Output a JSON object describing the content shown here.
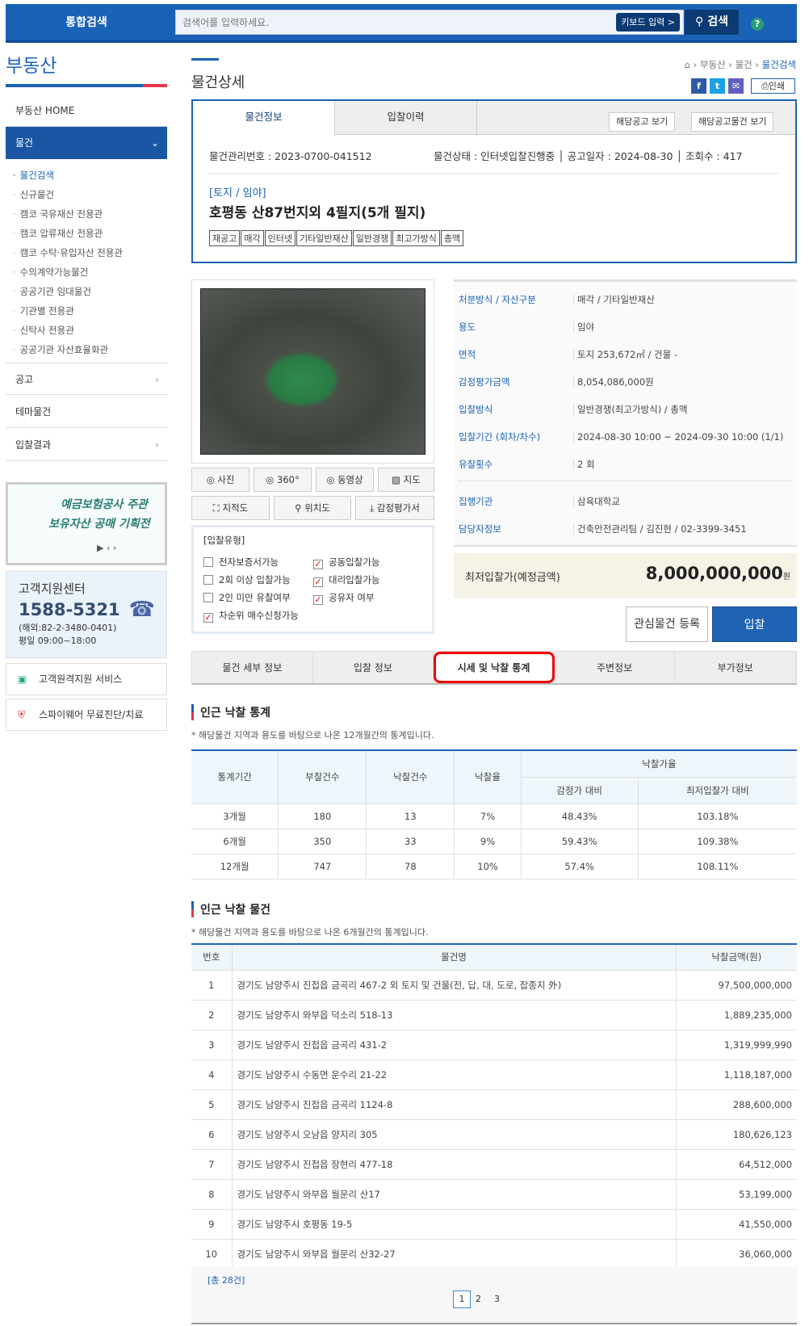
{
  "topbar": {
    "label": "통합검색",
    "search_placeholder": "검색어를 입력하세요.",
    "keyboard_label": "키보드 입력 >",
    "search_label": "검색",
    "help": "?"
  },
  "sidebar": {
    "title": "부동산",
    "home": "부동산 HOME",
    "active": "물건",
    "subitems": [
      "물건검색",
      "신규물건",
      "캠코 국유재산 전용관",
      "캠코 압류재산 전용관",
      "캠코 수탁·유입자산 전용관",
      "수의계약가능물건",
      "공공기관 임대물건",
      "기관별 전용관",
      "신탁사 전용관",
      "공공기관 자산효율화관"
    ],
    "menus": [
      "공고",
      "테마물건",
      "입찰결과"
    ],
    "banner": {
      "line1": "예금보험공사 주관",
      "line2": "보유자산 공매 기획전"
    },
    "cs": {
      "title": "고객지원센터",
      "phone": "1588-5321",
      "overseas": "(해외:82-2-3480-0401)",
      "hours": "평일 09:00~18:00"
    },
    "services": [
      "고객원격지원 서비스",
      "스파이웨어 무료진단/치료"
    ]
  },
  "page": {
    "title": "물건상세",
    "breadcrumb": [
      "부동산",
      "물건",
      "물건검색"
    ],
    "print": "인쇄"
  },
  "info": {
    "tabs": [
      "물건정보",
      "입찰이력"
    ],
    "buttons": [
      "해당공고 보기",
      "해당공고물건 보기"
    ],
    "mgmt_no": "물건관리번호 : 2023-0700-041512",
    "status": "물건상태 : 인터넷입찰진행중",
    "notice_date": "공고일자 : 2024-08-30",
    "views": "조회수 : 417",
    "category": "[토지 / 임야]",
    "name": "호평동 산87번지외 4필지(5개 필지)",
    "tags": [
      "재공고",
      "매각",
      "인터넷",
      "기타일반재산",
      "일반경쟁",
      "최고가방식",
      "총액"
    ]
  },
  "media_buttons": [
    "사진",
    "360°",
    "동영상",
    "지도",
    "지적도",
    "위치도",
    "감정평가서"
  ],
  "bid_type": {
    "title": "[입찰유형]",
    "options": [
      {
        "label": "전자보증서가능",
        "checked": false
      },
      {
        "label": "공동입찰가능",
        "checked": true
      },
      {
        "label": "2회 이상 입찰가능",
        "checked": false
      },
      {
        "label": "대리입찰가능",
        "checked": true
      },
      {
        "label": "2인 미만 유찰여부",
        "checked": false
      },
      {
        "label": "공유자 여부",
        "checked": true
      },
      {
        "label": "차순위 매수신청가능",
        "checked": true
      }
    ]
  },
  "spec": [
    {
      "k": "처분방식 / 자산구분",
      "v": "매각 / 기타일반재산"
    },
    {
      "k": "용도",
      "v": "임야"
    },
    {
      "k": "면적",
      "v": "토지 253,672㎡ / 건물 -"
    },
    {
      "k": "감정평가금액",
      "v": "8,054,086,000원"
    },
    {
      "k": "입찰방식",
      "v": "일반경쟁(최고가방식) / 총액"
    },
    {
      "k": "입찰기간 (회차/차수)",
      "v": "2024-08-30 10:00 ~ 2024-09-30 10:00 (1/1)"
    },
    {
      "k": "유찰횟수",
      "v": "2 회"
    },
    {
      "k": "집행기관",
      "v": "삼육대학교"
    },
    {
      "k": "담당자정보",
      "v": "건축안전관리팀 / 김진현 / 02-3399-3451"
    }
  ],
  "price": {
    "label": "최저입찰가(예정금액)",
    "value": "8,000,000,000",
    "unit": "원"
  },
  "actions": {
    "watch": "관심물건 등록",
    "bid": "입찰"
  },
  "section_tabs": [
    "물건 세부 정보",
    "입찰 정보",
    "시세 및 낙찰 통계",
    "주변정보",
    "부가정보"
  ],
  "stats": {
    "title": "인근 낙찰 통계",
    "note": "* 해당물건 지역과 용도를 바탕으로 나온 12개월간의 통계입니다.",
    "headers": [
      "통계기간",
      "부찰건수",
      "낙찰건수",
      "낙찰율",
      "낙찰가율",
      "감정가 대비",
      "최저입찰가 대비"
    ],
    "rows": [
      [
        "3개월",
        "180",
        "13",
        "7%",
        "48.43%",
        "103.18%"
      ],
      [
        "6개월",
        "350",
        "33",
        "9%",
        "59.43%",
        "109.38%"
      ],
      [
        "12개월",
        "747",
        "78",
        "10%",
        "57.4%",
        "108.11%"
      ]
    ]
  },
  "recent": {
    "title": "인근 낙찰 물건",
    "note": "* 해당물건 지역과 용도를 바탕으로 나온 6개월간의 통계입니다.",
    "headers": [
      "번호",
      "물건명",
      "낙찰금액(원)"
    ],
    "rows": [
      [
        "1",
        "경기도 남양주시 진접읍 금곡리 467-2 외 토지 및 건물(전, 답, 대, 도로, 잡종지 外)",
        "97,500,000,000"
      ],
      [
        "2",
        "경기도 남양주시 와부읍 덕소리 518-13",
        "1,889,235,000"
      ],
      [
        "3",
        "경기도 남양주시 진접읍 금곡리 431-2",
        "1,319,999,990"
      ],
      [
        "4",
        "경기도 남양주시 수동면 운수리 21-22",
        "1,118,187,000"
      ],
      [
        "5",
        "경기도 남양주시 진접읍 금곡리 1124-8",
        "288,600,000"
      ],
      [
        "6",
        "경기도 남양주시 오남읍 양지리 305",
        "180,626,123"
      ],
      [
        "7",
        "경기도 남양주시 진접읍 장현리 477-18",
        "64,512,000"
      ],
      [
        "8",
        "경기도 남양주시 와부읍 월문리 산17",
        "53,199,000"
      ],
      [
        "9",
        "경기도 남양주시 호평동 19-5",
        "41,550,000"
      ],
      [
        "10",
        "경기도 남양주시 와부읍 월문리 산32-27",
        "36,060,000"
      ]
    ],
    "total": "[총 28건]",
    "pages": [
      "1",
      "2",
      "3"
    ]
  }
}
